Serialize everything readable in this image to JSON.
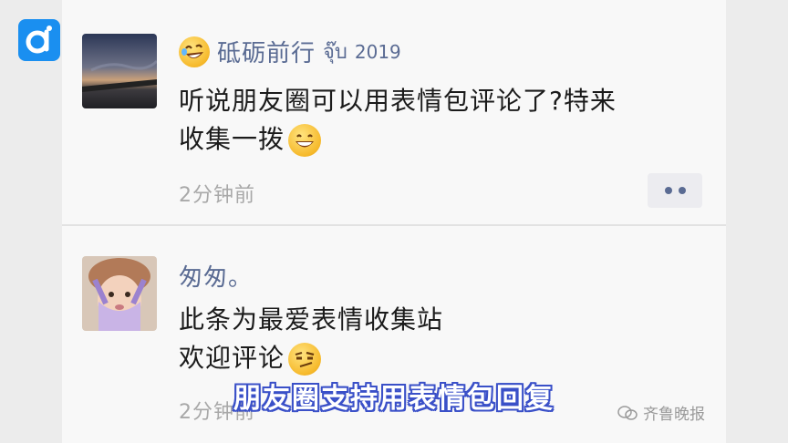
{
  "app": {
    "logo_icon": "app-logo-icon",
    "logo_color": "#1a8ff0"
  },
  "posts": [
    {
      "user": {
        "name_emoji": "rofl-emoji-icon",
        "name": "砥砺前行",
        "name_thai": "จุ๊บ",
        "name_year": "2019"
      },
      "content_lines": [
        "听说朋友圈可以用表情包评论了?特来",
        "收集一拨"
      ],
      "content_emoji": "grinning-emoji-icon",
      "time": "2分钟前"
    },
    {
      "user": {
        "name": "匆匆。"
      },
      "content_lines": [
        "此条为最爱表情收集站",
        "欢迎评论"
      ],
      "content_emoji": "smirk-emoji-icon",
      "time": "2分钟前"
    }
  ],
  "subtitle": "朋友圈支持用表情包回复",
  "watermark": {
    "icon": "wechat-icon",
    "text": "齐鲁晚报"
  },
  "colors": {
    "name_color": "#5a6b93",
    "subtitle_stroke": "#3a50c8"
  }
}
